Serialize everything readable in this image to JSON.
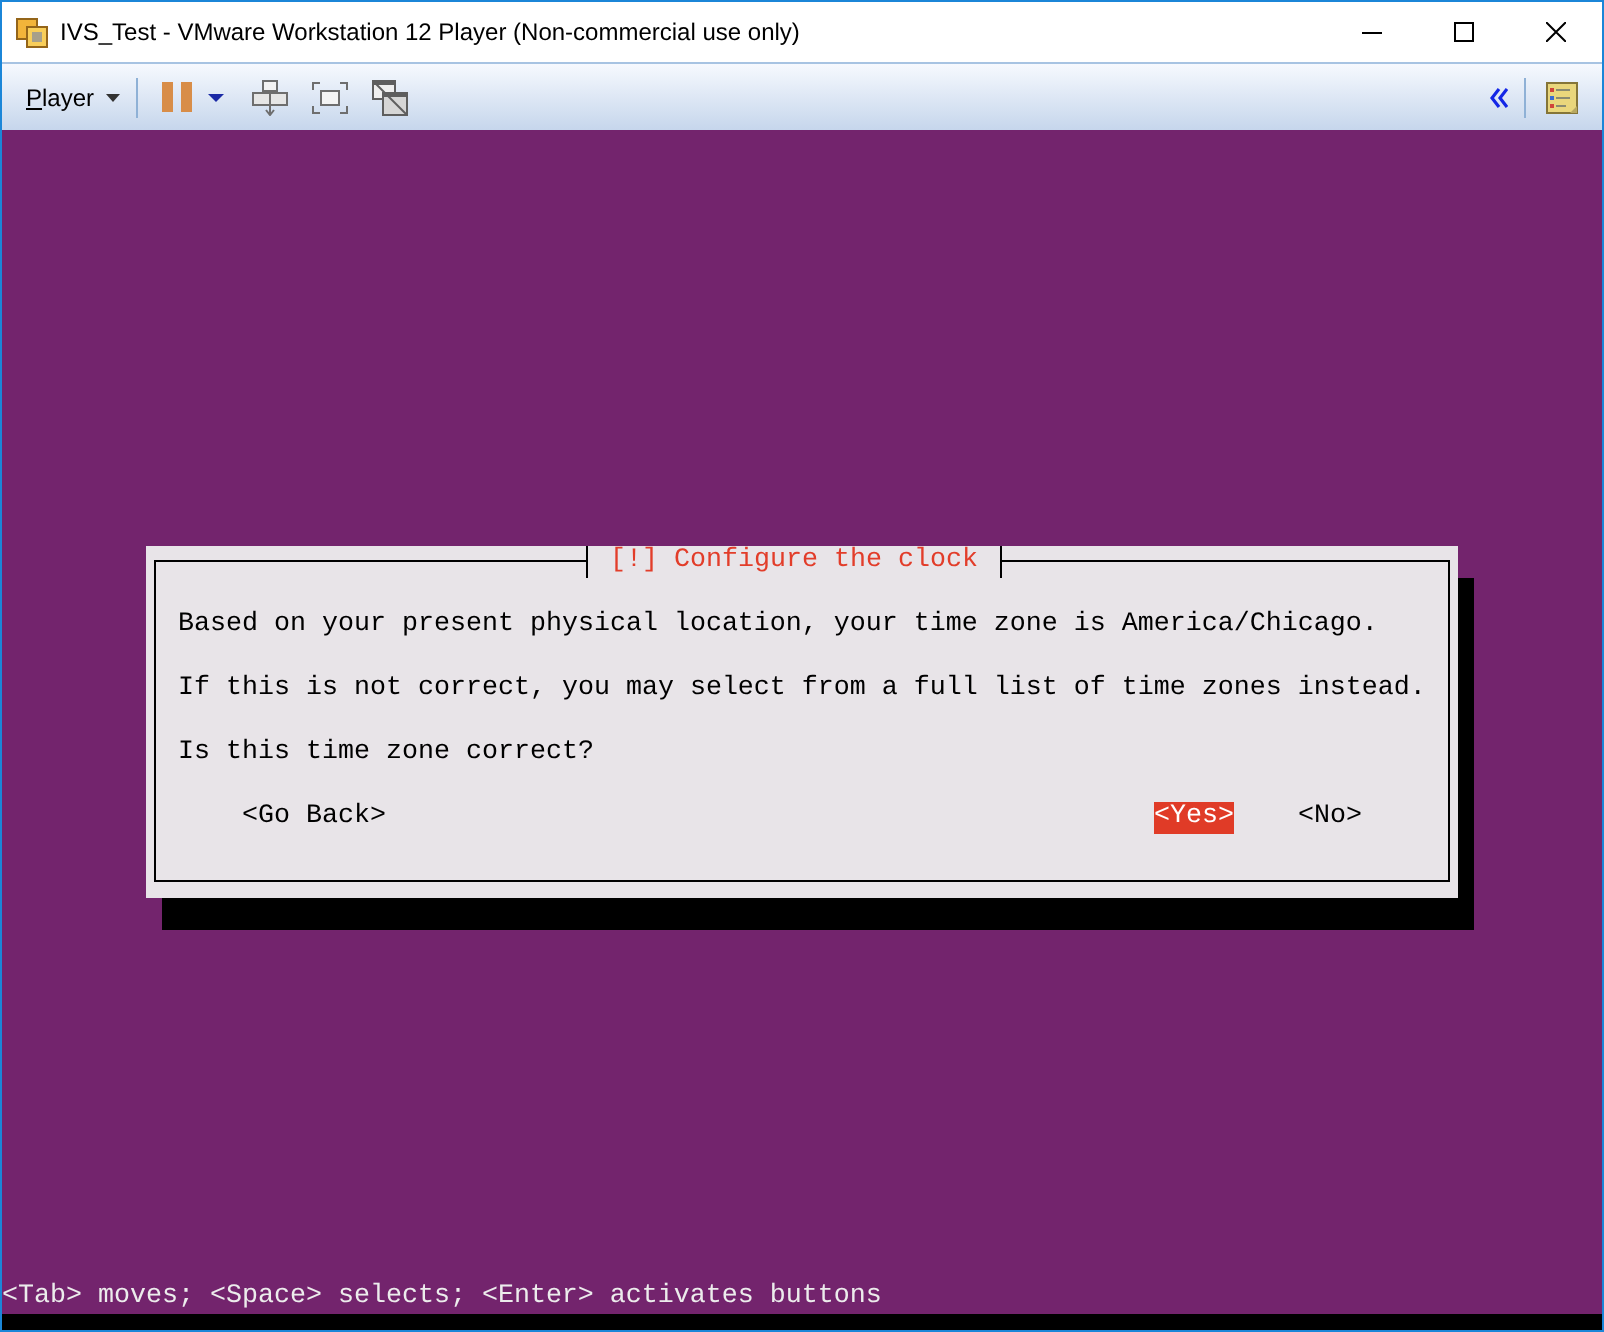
{
  "window": {
    "title": "IVS_Test - VMware Workstation 12 Player (Non-commercial use only)"
  },
  "toolbar": {
    "menu": "Player"
  },
  "console": {
    "dialog": {
      "title": "[!] Configure the clock",
      "paragraphs": [
        "Based on your present physical location, your time zone is America/Chicago.",
        "If this is not correct, you may select from a full list of time zones instead.",
        "Is this time zone correct?"
      ],
      "buttons": [
        {
          "label": "<Go Back>",
          "selected": false
        },
        {
          "label": "<Yes>",
          "selected": true
        },
        {
          "label": "<No>",
          "selected": false
        }
      ]
    },
    "status_line": "<Tab> moves; <Space> selects; <Enter> activates buttons"
  }
}
